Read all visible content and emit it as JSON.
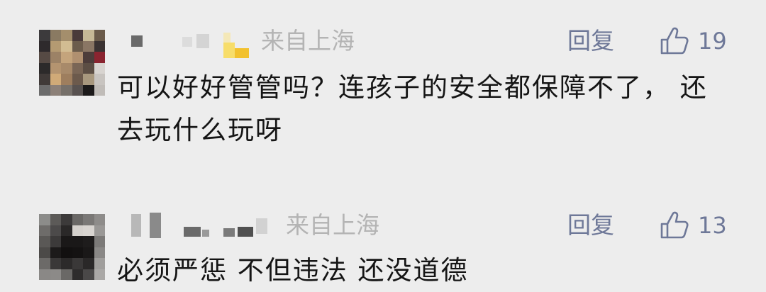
{
  "comments": [
    {
      "location": "来自上海",
      "reply_label": "回复",
      "like_count": "19",
      "text": "可以好好管管吗？连孩子的安全都保障不了，  还去玩什么玩呀"
    },
    {
      "location": "来自上海",
      "reply_label": "回复",
      "like_count": "13",
      "text": "必须严惩  不但违法  还没道德"
    }
  ],
  "icons": {
    "like": "thumbs-up-icon",
    "badge": "level-badge-icon"
  },
  "colors": {
    "background": "#ededed",
    "text": "#151515",
    "muted": "#b4b4b4",
    "link": "#6e7898",
    "badge": "#f2c12e"
  }
}
